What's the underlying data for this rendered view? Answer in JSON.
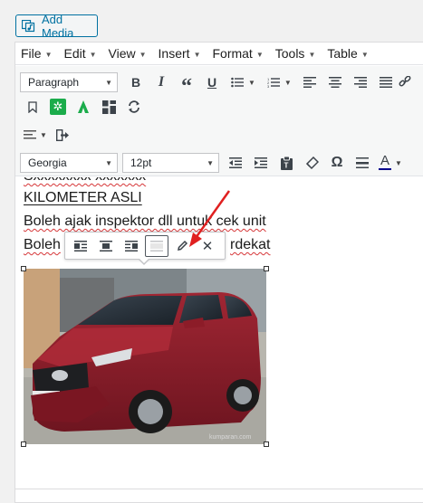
{
  "add_media": {
    "label": "Add Media",
    "icon": "media-icon"
  },
  "menubar": [
    {
      "label": "File",
      "icon": "caret-down-icon"
    },
    {
      "label": "Edit",
      "icon": "caret-down-icon"
    },
    {
      "label": "View",
      "icon": "caret-down-icon"
    },
    {
      "label": "Insert",
      "icon": "caret-down-icon"
    },
    {
      "label": "Format",
      "icon": "caret-down-icon"
    },
    {
      "label": "Tools",
      "icon": "caret-down-icon"
    },
    {
      "label": "Table",
      "icon": "caret-down-icon"
    }
  ],
  "toolbar": {
    "block_format": "Paragraph",
    "font_family": "Georgia",
    "font_size": "12pt",
    "text_color_letter": "A",
    "omega": "Ω",
    "accent_color": "#00a0d2",
    "green_icon_color": "#1bac4b",
    "text_color_underline": "#00008b"
  },
  "content": {
    "line0": "Sxxxxxxxx xxxxxxx",
    "line1": "KILOMETER ASLI",
    "line2": "Boleh ajak inspektor dll untuk cek unit",
    "line3_start": "Boleh",
    "line3_end": "rdekat"
  },
  "image_toolbar": {
    "buttons": [
      "align-left-icon",
      "align-center-icon",
      "align-right-icon",
      "no-align-icon",
      "edit-pencil-icon",
      "remove-x-icon"
    ]
  },
  "annotation": {
    "arrow_color": "#e02020"
  },
  "image": {
    "subject": "red-car-photo",
    "watermark": "kumparan.com"
  }
}
